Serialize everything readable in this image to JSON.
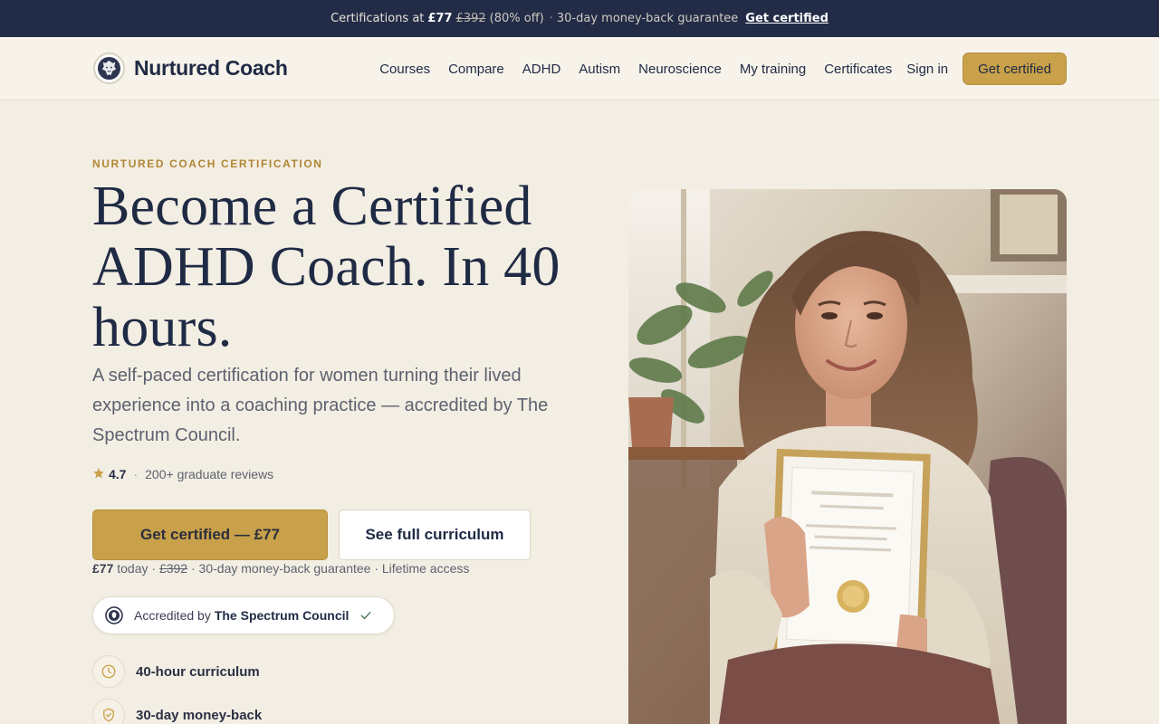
{
  "promo": {
    "lead": "Certifications at",
    "price": "£77",
    "old_price": "£392",
    "discount": "(80% off)",
    "separator": "·",
    "guarantee": "30-day money-back guarantee",
    "cta": "Get certified"
  },
  "header": {
    "brand": "Nurtured Coach",
    "nav": [
      "Courses",
      "Compare",
      "ADHD",
      "Autism",
      "Neuroscience",
      "My training",
      "Certificates"
    ],
    "sign_in": "Sign in",
    "cta": "Get certified"
  },
  "hero": {
    "eyebrow": "NURTURED COACH CERTIFICATION",
    "headline_l1": "Become a Certified",
    "headline_l2": "ADHD Coach. In 40",
    "headline_l3": "hours.",
    "subtitle": "A self-paced certification for women turning their lived experience into a coaching practice — accredited by The Spectrum Council.",
    "rating": {
      "score": "4.7",
      "sep": "·",
      "reviews": "200+ graduate reviews"
    },
    "primary_cta": "Get certified — £77",
    "secondary_cta": "See full curriculum",
    "price_note": {
      "today": "£77",
      "today_suffix": " today · ",
      "old": "£392",
      "rest": " · 30-day money-back guarantee · Lifetime access"
    },
    "accreditation": {
      "prefix": "Accredited by",
      "org": "The Spectrum Council"
    },
    "features": [
      {
        "icon": "clock-icon",
        "label": "40-hour curriculum"
      },
      {
        "icon": "shield-check-icon",
        "label": "30-day money-back"
      }
    ]
  },
  "colors": {
    "navy": "#1f2a44",
    "gold": "#c9a14a",
    "cream": "#f3eee3"
  }
}
